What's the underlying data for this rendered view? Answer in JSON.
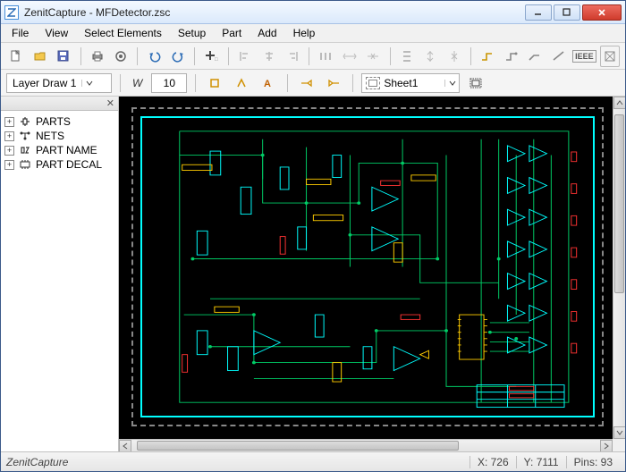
{
  "window": {
    "title": "ZenitCapture - MFDetector.zsc"
  },
  "menu": {
    "items": [
      "File",
      "View",
      "Select Elements",
      "Setup",
      "Part",
      "Add",
      "Help"
    ]
  },
  "toolbar1": {
    "ieee_label": "IEEE"
  },
  "toolbar2": {
    "layer_label": "Layer Draw 1",
    "width_label": "W",
    "width_value": "10",
    "sheet_label": "Sheet1"
  },
  "tree": {
    "items": [
      {
        "label": "PARTS",
        "icon": "parts-icon"
      },
      {
        "label": "NETS",
        "icon": "nets-icon"
      },
      {
        "label": "PART NAME",
        "icon": "partname-icon"
      },
      {
        "label": "PART DECAL",
        "icon": "partdecal-icon"
      }
    ]
  },
  "status": {
    "app": "ZenitCapture",
    "x_label": "X:",
    "x_value": "726",
    "y_label": "Y:",
    "y_value": "7111",
    "pins_label": "Pins:",
    "pins_value": "93"
  },
  "colors": {
    "accent_cyan": "#00ffff",
    "trace_green": "#00cc66",
    "trace_yellow": "#ffcc00",
    "trace_red": "#ff3333",
    "canvas_bg": "#000000"
  }
}
